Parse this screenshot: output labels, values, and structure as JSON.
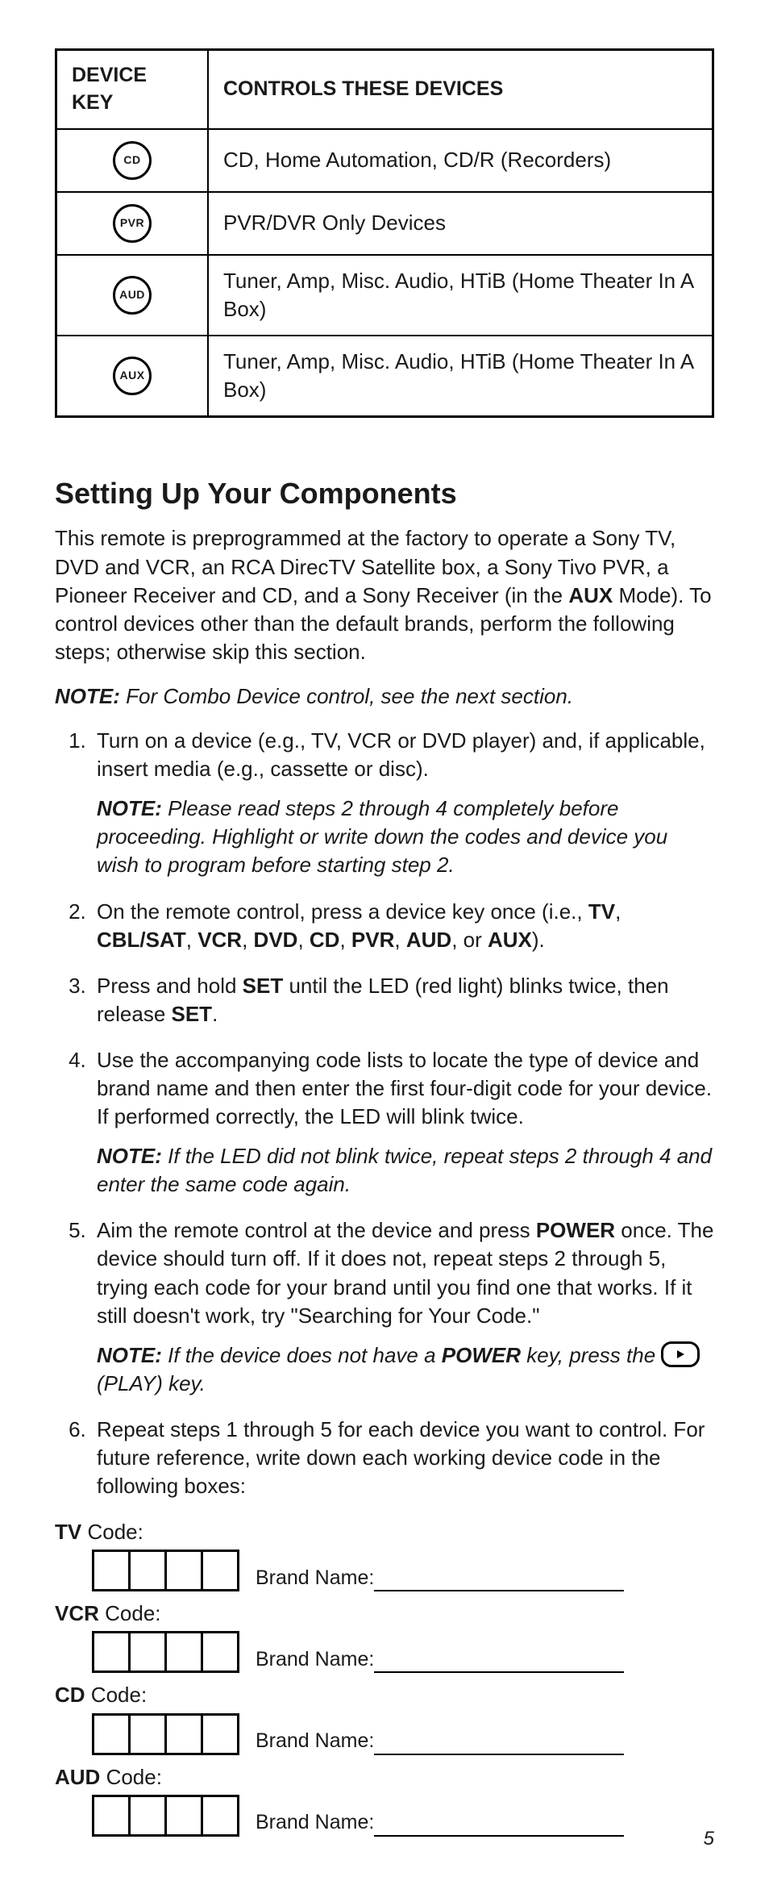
{
  "table": {
    "headers": {
      "col1": "DEVICE KEY",
      "col2": "CONTROLS THESE DEVICES"
    },
    "rows": [
      {
        "key_label": "CD",
        "desc": "CD, Home Automation, CD/R (Recorders)"
      },
      {
        "key_label": "PVR",
        "desc": "PVR/DVR Only Devices"
      },
      {
        "key_label": "AUD",
        "desc": "Tuner, Amp, Misc. Audio, HTiB (Home Theater In A Box)"
      },
      {
        "key_label": "AUX",
        "desc": "Tuner, Amp, Misc. Audio, HTiB (Home Theater In A Box)"
      }
    ]
  },
  "heading": "Setting Up Your Components",
  "intro_parts": {
    "a": "This remote is preprogrammed at the factory to operate a Sony TV, DVD and VCR, an RCA DirecTV Satellite box, a Sony Tivo PVR, a Pioneer Receiver and CD, and a Sony Receiver (in the ",
    "aux": "AUX",
    "b": " Mode). To control devices other than the default brands, perform the following steps; otherwise skip this section."
  },
  "top_note": {
    "label": "NOTE:",
    "text": " For Combo Device control, see the next section."
  },
  "steps": {
    "s1": {
      "text": "Turn on a device (e.g., TV, VCR or DVD player) and, if applicable, insert media (e.g., cassette or disc).",
      "note_label": "NOTE:",
      "note_text": " Please read steps 2 through 4 completely before proceeding. Highlight or write down the codes and device you wish to program before starting step 2."
    },
    "s2": {
      "a": "On the remote control, press a device key once (i.e., ",
      "k": {
        "tv": "TV",
        "cbl": "CBL/SAT",
        "vcr": "VCR",
        "dvd": "DVD",
        "cd": "CD",
        "pvr": "PVR",
        "aud": "AUD",
        "aux": "AUX"
      },
      "sep": ", ",
      "or": ", or ",
      "b": ")."
    },
    "s3": {
      "a": "Press and hold ",
      "set": "SET",
      "b": " until the LED (red light) blinks twice, then release ",
      "c": "."
    },
    "s4": {
      "text": "Use the accompanying code lists to locate the type of device and brand name and then enter the first four-digit code for your device. If performed correctly, the LED will blink twice.",
      "note_label": "NOTE:",
      "note_text": " If the LED did not blink twice, repeat steps 2 through 4 and enter the same code again."
    },
    "s5": {
      "a": "Aim the remote control at the device and press ",
      "power": "POWER",
      "b": " once. The device should turn off. If it does not, repeat steps 2 through 5, trying each code for your brand until you find one that works. If it still doesn't work, try \"Searching for Your Code.\"",
      "note_label": "NOTE:",
      "note_a": " If the device does not have a ",
      "note_power": "POWER",
      "note_b": " key, press the ",
      "note_c": " (PLAY) key."
    },
    "s6": {
      "text": "Repeat steps 1 through 5 for each device you want to control. For future reference, write down each working device code in the following boxes:"
    }
  },
  "codes": {
    "labels": {
      "tv": "TV",
      "vcr": "VCR",
      "cd": "CD",
      "aud": "AUD"
    },
    "code_suffix": " Code:",
    "brand_label": "Brand Name:"
  },
  "page_number": "5"
}
